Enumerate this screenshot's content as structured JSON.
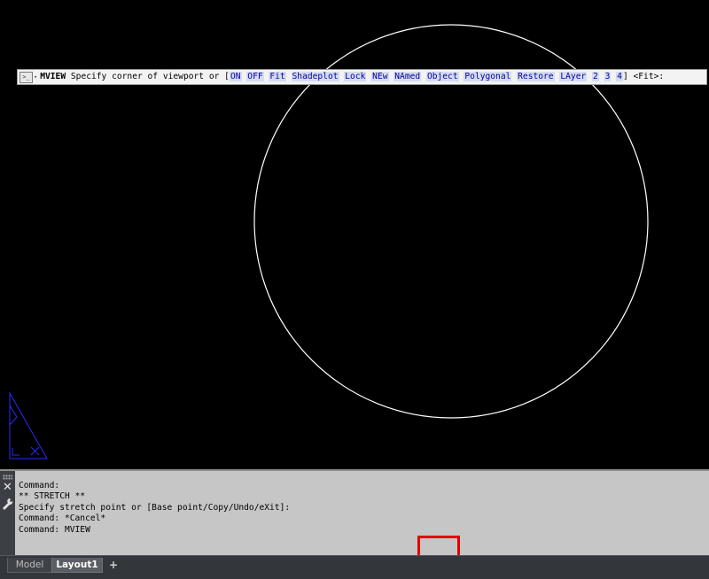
{
  "drawing": {
    "background": "#000000",
    "circle_color": "#ffffff",
    "ucs_icon_color": "#2a2aff"
  },
  "command_line": {
    "history": [
      "Command:",
      "** STRETCH **",
      "Specify stretch point or [Base point/Copy/Undo/eXit]:",
      "Command: *Cancel*",
      "Command: MVIEW"
    ],
    "input": {
      "button_icon": ">_",
      "command": "MVIEW",
      "prompt": "Specify corner of viewport or [",
      "options": [
        "ON",
        "OFF",
        "Fit",
        "Shadeplot",
        "Lock",
        "NEw",
        "NAmed",
        "Object",
        "Polygonal",
        "Restore",
        "LAyer",
        "2",
        "3",
        "4"
      ],
      "suffix": "] <Fit>:"
    },
    "highlighted_option": "Object",
    "highlight_color": "#e00000"
  },
  "tabs": {
    "model": "Model",
    "layout1": "Layout1",
    "add": "+"
  }
}
